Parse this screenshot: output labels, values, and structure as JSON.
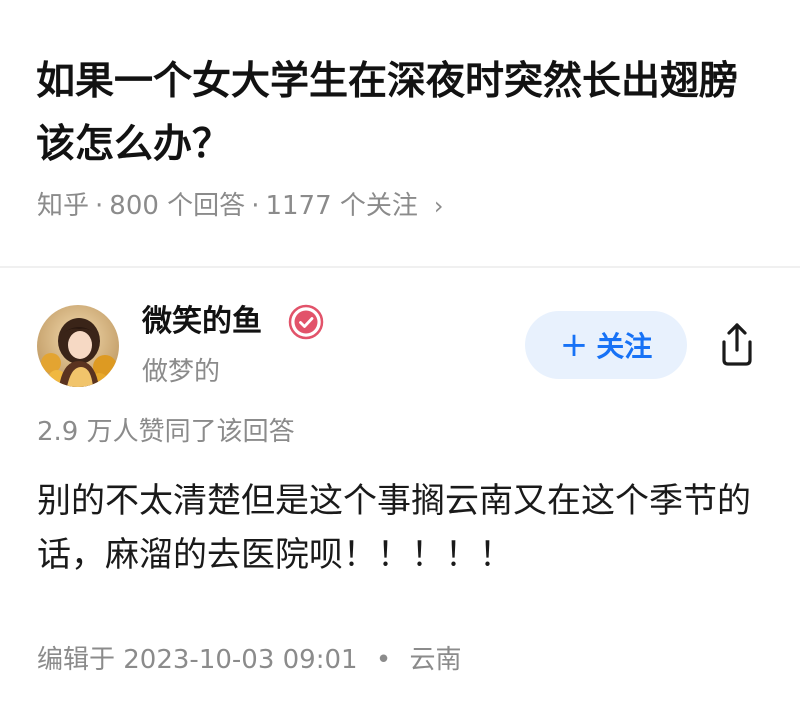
{
  "question": {
    "title": "如果一个女大学生在深夜时突然长出翅膀该怎么办？"
  },
  "meta": {
    "source": "知乎",
    "answers": "800 个回答",
    "followers": "1177 个关注",
    "separator": "·",
    "chevron": "›"
  },
  "author": {
    "name": "微笑的鱼",
    "bio": "做梦的",
    "follow_label": "关注",
    "follow_plus": "+"
  },
  "answer": {
    "upvotes": "2.9 万人赞同了该回答",
    "body": "别的不太清楚但是这个事搁云南又在这个季节的话，麻溜的去医院呗！！！！！",
    "edited": "编辑于 2023-10-03 09:01",
    "location": "云南",
    "dot": "•"
  },
  "colors": {
    "accent": "#1772f6",
    "follow_bg": "#e8f1fd",
    "badge": "#e2536a",
    "muted_text": "#8b8b8b"
  },
  "icons": [
    "verified-badge-icon",
    "share-icon",
    "chevron-right-icon",
    "plus-icon"
  ]
}
